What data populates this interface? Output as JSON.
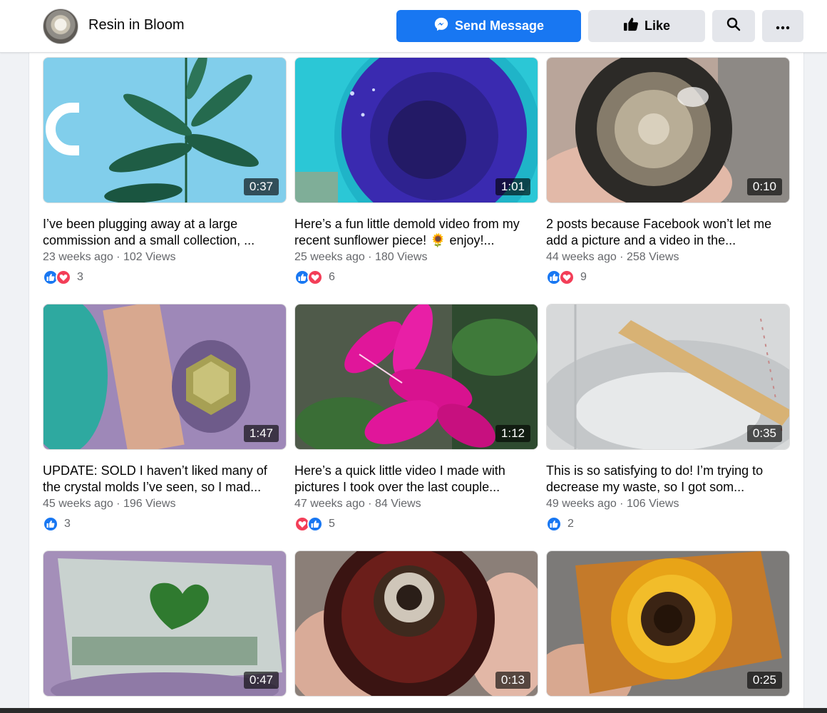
{
  "header": {
    "page_name": "Resin in Bloom",
    "send_label": "Send Message",
    "like_label": "Like",
    "icons": {
      "send": "messenger-icon",
      "like": "thumbs-up-icon",
      "search": "search-icon",
      "more": "more-dots-icon"
    }
  },
  "colors": {
    "primary": "#1877f2",
    "like": "#1877f2",
    "love": "#f33e58"
  },
  "videos": [
    {
      "duration": "0:37",
      "caption": "I’ve been plugging away at a large commission and a small collection, ...",
      "age": "23 weeks ago",
      "views": "102 Views",
      "reactions": [
        "like",
        "love"
      ],
      "count": "3"
    },
    {
      "duration": "1:01",
      "caption": "Here’s a fun little demold video from my recent sunflower piece! 🌻 enjoy!...",
      "age": "25 weeks ago",
      "views": "180 Views",
      "reactions": [
        "like",
        "love"
      ],
      "count": "6"
    },
    {
      "duration": "0:10",
      "caption": "2 posts because Facebook won’t let me add a picture and a video in the...",
      "age": "44 weeks ago",
      "views": "258 Views",
      "reactions": [
        "like",
        "love"
      ],
      "count": "9"
    },
    {
      "duration": "1:47",
      "caption": "UPDATE: SOLD I haven’t liked many of the crystal molds I’ve seen, so I mad...",
      "age": "45 weeks ago",
      "views": "196 Views",
      "reactions": [
        "like"
      ],
      "count": "3"
    },
    {
      "duration": "1:12",
      "caption": "Here’s a quick little video I made with pictures I took over the last couple...",
      "age": "47 weeks ago",
      "views": "84 Views",
      "reactions": [
        "love",
        "like"
      ],
      "count": "5"
    },
    {
      "duration": "0:35",
      "caption": "This is so satisfying to do! I’m trying to decrease my waste, so I got som...",
      "age": "49 weeks ago",
      "views": "106 Views",
      "reactions": [
        "like"
      ],
      "count": "2"
    },
    {
      "duration": "0:47"
    },
    {
      "duration": "0:13"
    },
    {
      "duration": "0:25"
    }
  ]
}
